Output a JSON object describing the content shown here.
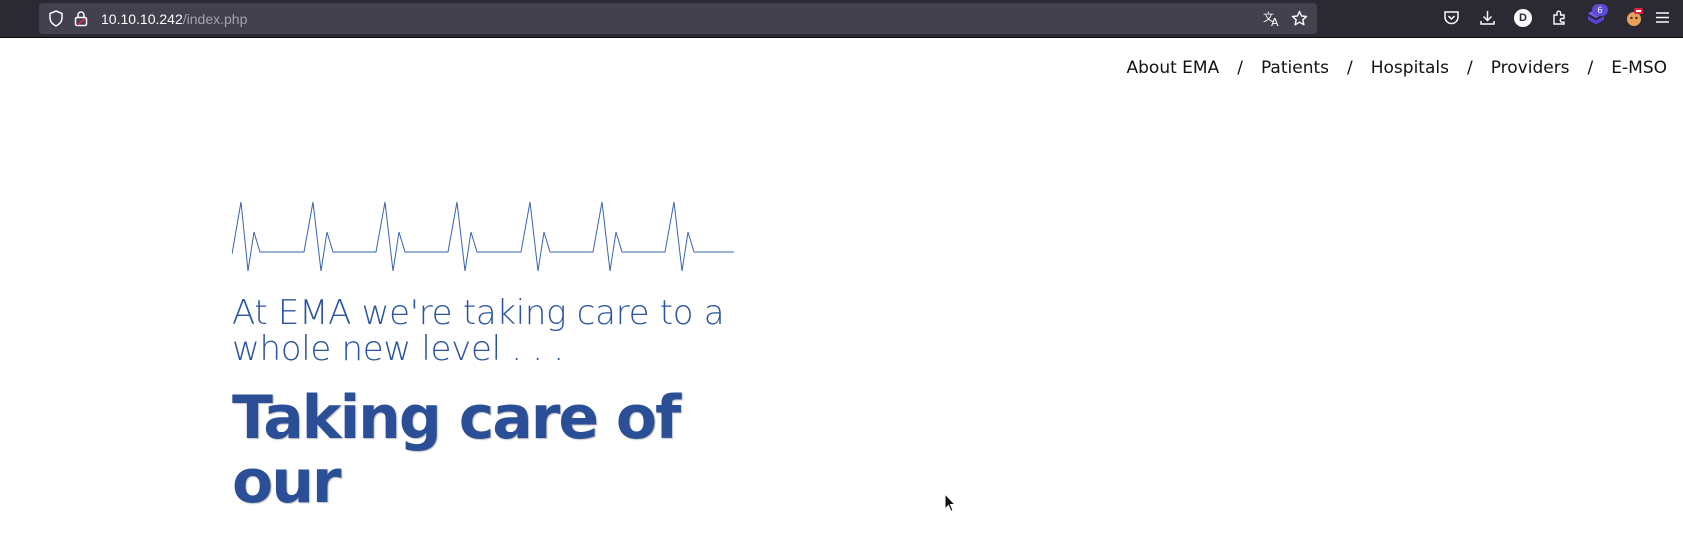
{
  "browser": {
    "url_host": "10.10.10.242",
    "url_path": "/index.php",
    "avatar_letter": "D",
    "extension_badge": "6",
    "colors": {
      "toolbar_bg": "#2b2a33",
      "urlbar_bg": "#42414d"
    },
    "icons": [
      "shield-icon",
      "lock-icon",
      "translate-icon",
      "bookmark-star-icon",
      "pocket-icon",
      "download-icon",
      "account-avatar",
      "extensions-icon",
      "extension-icon",
      "extension-icon",
      "menu-icon"
    ]
  },
  "nav": {
    "items": [
      {
        "label": "About EMA"
      },
      {
        "label": "Patients"
      },
      {
        "label": "Hospitals"
      },
      {
        "label": "Providers"
      },
      {
        "label": "E-MSO"
      }
    ],
    "separator": "/"
  },
  "hero": {
    "tagline": "At EMA we're taking care to a whole new level . . .",
    "headline_line1": "Taking care of",
    "headline_line2": "our",
    "colors": {
      "tagline": "#2b55a0",
      "headline": "#2a4f97",
      "ekg_line": "#3a63b0"
    }
  }
}
